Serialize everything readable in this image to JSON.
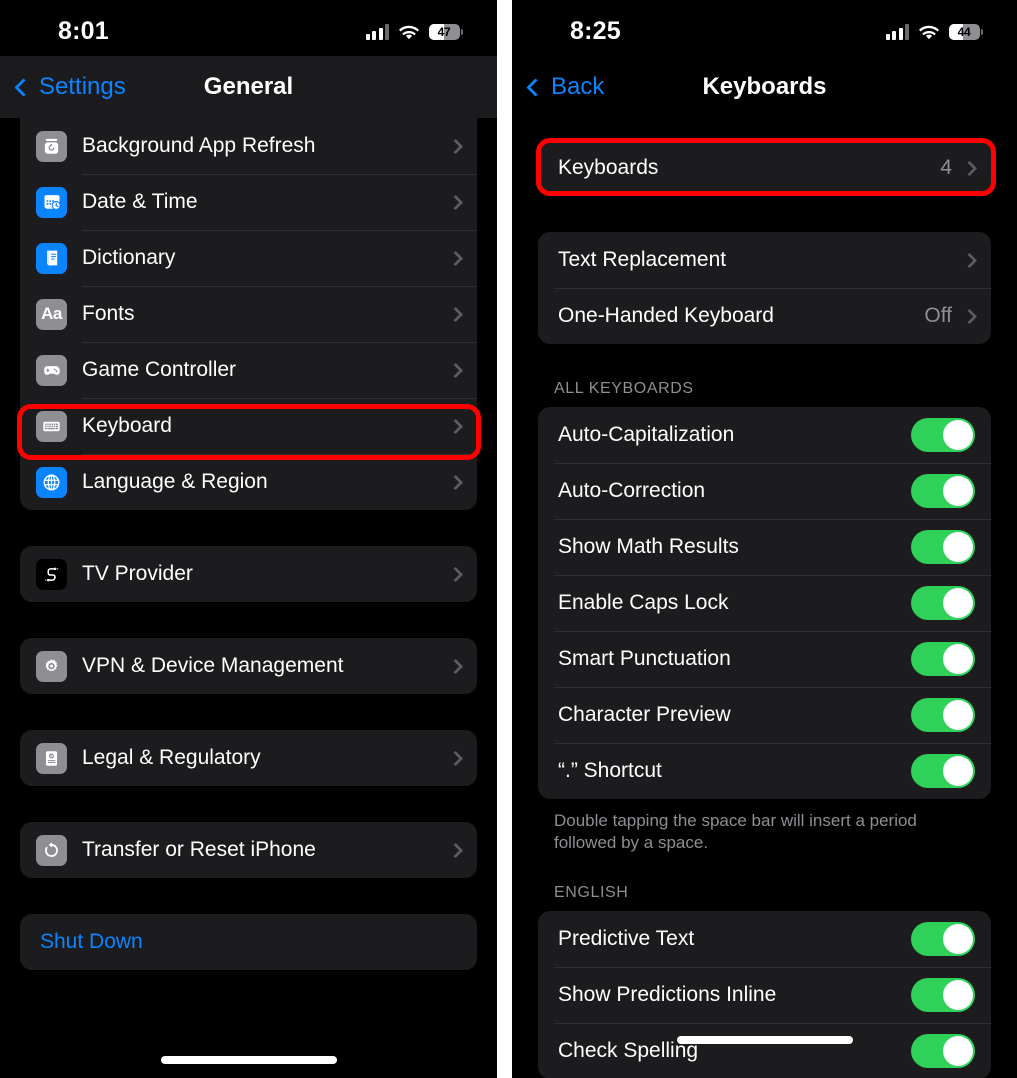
{
  "colors": {
    "accent_blue": "#0a84ff",
    "toggle_green": "#30d158",
    "highlight_red": "#ff0000",
    "group_bg": "#1c1c1e",
    "secondary_text": "#8e8e93"
  },
  "left_panel": {
    "status_bar": {
      "time": "8:01",
      "battery_percent": "47",
      "cellular_icon": "cellular-bars-icon",
      "wifi_icon": "wifi-icon",
      "battery_icon": "battery-icon"
    },
    "nav": {
      "back_label": "Settings",
      "title": "General",
      "back_icon": "chevron-left-icon"
    },
    "group_1": [
      {
        "icon": "background-app-refresh-icon",
        "icon_color": "gray",
        "label": "Background App Refresh",
        "accessory": "chevron-right-icon"
      },
      {
        "icon": "date-and-time-icon",
        "icon_color": "blue",
        "label": "Date & Time",
        "accessory": "chevron-right-icon"
      },
      {
        "icon": "dictionary-icon",
        "icon_color": "blue",
        "label": "Dictionary",
        "accessory": "chevron-right-icon"
      },
      {
        "icon": "fonts-icon",
        "icon_color": "gray",
        "label": "Fonts",
        "accessory": "chevron-right-icon"
      },
      {
        "icon": "game-controller-icon",
        "icon_color": "gray",
        "label": "Game Controller",
        "accessory": "chevron-right-icon"
      },
      {
        "icon": "keyboard-icon",
        "icon_color": "gray",
        "label": "Keyboard",
        "accessory": "chevron-right-icon",
        "highlighted": true
      },
      {
        "icon": "language-and-region-icon",
        "icon_color": "blue",
        "label": "Language & Region",
        "accessory": "chevron-right-icon"
      }
    ],
    "group_2": [
      {
        "icon": "tv-provider-icon",
        "icon_color": "black",
        "label": "TV Provider",
        "accessory": "chevron-right-icon"
      }
    ],
    "group_3": [
      {
        "icon": "vpn-device-management-icon",
        "icon_color": "gray",
        "label": "VPN & Device Management",
        "accessory": "chevron-right-icon"
      }
    ],
    "group_4": [
      {
        "icon": "legal-regulatory-icon",
        "icon_color": "gray",
        "label": "Legal & Regulatory",
        "accessory": "chevron-right-icon"
      }
    ],
    "group_5": [
      {
        "icon": "transfer-reset-iphone-icon",
        "icon_color": "gray",
        "label": "Transfer or Reset iPhone",
        "accessory": "chevron-right-icon"
      }
    ],
    "group_6": [
      {
        "label": "Shut Down",
        "style": "blue"
      }
    ]
  },
  "right_panel": {
    "status_bar": {
      "time": "8:25",
      "battery_percent": "44",
      "cellular_icon": "cellular-bars-icon",
      "wifi_icon": "wifi-icon",
      "battery_icon": "battery-icon"
    },
    "nav": {
      "back_label": "Back",
      "title": "Keyboards",
      "back_icon": "chevron-left-icon"
    },
    "group_keyboards": [
      {
        "label": "Keyboards",
        "value": "4",
        "accessory": "chevron-right-icon",
        "highlighted": true
      }
    ],
    "group_text": [
      {
        "label": "Text Replacement",
        "value": "",
        "accessory": "chevron-right-icon"
      },
      {
        "label": "One-Handed Keyboard",
        "value": "Off",
        "accessory": "chevron-right-icon"
      }
    ],
    "all_keyboards_header": "ALL KEYBOARDS",
    "all_keyboards_rows": [
      {
        "label": "Auto-Capitalization",
        "toggle": "on"
      },
      {
        "label": "Auto-Correction",
        "toggle": "on"
      },
      {
        "label": "Show Math Results",
        "toggle": "on"
      },
      {
        "label": "Enable Caps Lock",
        "toggle": "on"
      },
      {
        "label": "Smart Punctuation",
        "toggle": "on"
      },
      {
        "label": "Character Preview",
        "toggle": "on"
      },
      {
        "label": "“.” Shortcut",
        "toggle": "on"
      }
    ],
    "all_keyboards_footnote": "Double tapping the space bar will insert a period followed by a space.",
    "english_header": "ENGLISH",
    "english_rows": [
      {
        "label": "Predictive Text",
        "toggle": "on"
      },
      {
        "label": "Show Predictions Inline",
        "toggle": "on"
      },
      {
        "label": "Check Spelling",
        "toggle": "on"
      }
    ]
  }
}
